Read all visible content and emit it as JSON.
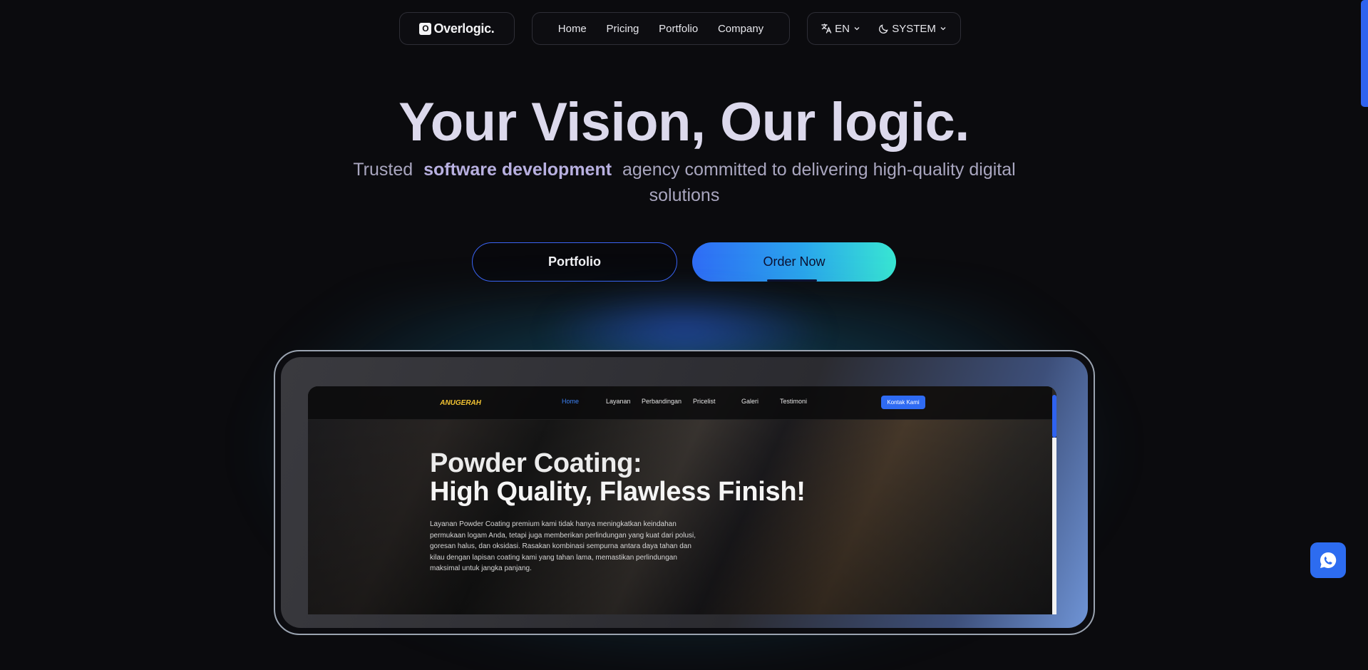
{
  "brand": {
    "name": "Overlogic.",
    "mark": "O"
  },
  "nav": {
    "links": [
      "Home",
      "Pricing",
      "Portfolio",
      "Company"
    ]
  },
  "settings": {
    "language": "EN",
    "theme": "SYSTEM"
  },
  "hero": {
    "title": "Your Vision, Our logic.",
    "subtitle_before": "Trusted",
    "subtitle_highlight": "software development",
    "subtitle_after": "agency committed to delivering high-quality digital solutions"
  },
  "buttons": {
    "portfolio": "Portfolio",
    "order": "Order Now"
  },
  "preview_site": {
    "logo_text": "ANUGERAH",
    "links": [
      "Home",
      "Layanan",
      "Perbandingan",
      "Pricelist",
      "Galeri",
      "Testimoni"
    ],
    "cta": "Kontak Kami",
    "headline_line1": "Powder Coating:",
    "headline_line2": "High Quality, Flawless Finish!",
    "paragraph": "Layanan Powder Coating premium kami tidak hanya meningkatkan keindahan permukaan logam Anda, tetapi juga memberikan perlindungan yang kuat dari polusi, goresan halus, dan oksidasi. Rasakan kombinasi sempurna antara daya tahan dan kilau dengan lapisan coating kami yang tahan lama, memastikan perlindungan maksimal untuk jangka panjang."
  },
  "colors": {
    "accent": "#2f6cf6",
    "teal": "#38e6d2",
    "background": "#0b0b0e"
  },
  "icons": {
    "language": "translate-icon",
    "theme": "moon-icon",
    "chat": "whatsapp-icon"
  }
}
